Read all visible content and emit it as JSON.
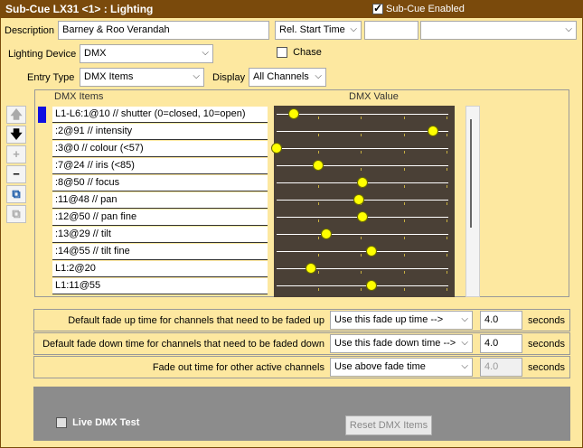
{
  "title": "Sub-Cue LX31 <1> : Lighting",
  "enabled_label": "Sub-Cue Enabled",
  "description": {
    "label": "Description",
    "value": "Barney & Roo Verandah"
  },
  "start_time": {
    "value": "Rel. Start Time"
  },
  "lighting_device": {
    "label": "Lighting Device",
    "value": "DMX"
  },
  "chase_label": "Chase",
  "entry_type": {
    "label": "Entry Type",
    "value": "DMX Items"
  },
  "display": {
    "label": "Display",
    "value": "All Channels"
  },
  "grid": {
    "col_items": "DMX Items",
    "col_value": "DMX Value",
    "rows": [
      {
        "label": "L1-L6:1@10 // shutter (0=closed, 10=open)",
        "value": 10
      },
      {
        "label": ":2@91 // intensity",
        "value": 91
      },
      {
        "label": ":3@0 // colour (<57)",
        "value": 0
      },
      {
        "label": ":7@24 // iris (<85)",
        "value": 24
      },
      {
        "label": ":8@50 // focus",
        "value": 50
      },
      {
        "label": ":11@48 // pan",
        "value": 48
      },
      {
        "label": ":12@50 // pan fine",
        "value": 50
      },
      {
        "label": ":13@29 // tilt",
        "value": 29
      },
      {
        "label": ":14@55 // tilt fine",
        "value": 55
      },
      {
        "label": "L1:2@20",
        "value": 20
      },
      {
        "label": "L1:11@55",
        "value": 55
      }
    ]
  },
  "fade_up": {
    "label": "Default fade up time for channels that need to be faded up",
    "option": "Use this fade up time -->",
    "value": "4.0",
    "unit": "seconds"
  },
  "fade_down": {
    "label": "Default fade down time for channels that need to be faded down",
    "option": "Use this fade down time -->",
    "value": "4.0",
    "unit": "seconds"
  },
  "fade_out": {
    "label": "Fade out time for other active channels",
    "option": "Use above fade time",
    "value": "4.0",
    "unit": "seconds"
  },
  "live_test_label": "Live DMX Test",
  "reset_label": "Reset DMX Items",
  "colors": {
    "title_bg": "#7a4a0c",
    "panel_bg": "#fde8a0",
    "knob": "#ffff00",
    "slider_bg": "#4a4036",
    "selection": "#1010e0"
  },
  "toolbar_icons": [
    "arrow-up-icon",
    "arrow-down-icon",
    "plus-icon",
    "minus-icon",
    "copy-icon",
    "paste-icon"
  ]
}
